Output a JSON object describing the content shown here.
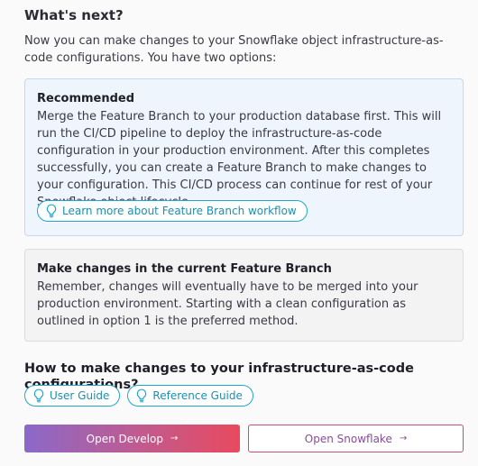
{
  "header": {
    "title": "What's next?"
  },
  "intro": "Now you can make changes to your Snowflake object infrastructure-as-code configurations. You have two options:",
  "recommended": {
    "title": "Recommended",
    "body": "Merge the Feature Branch to your production database first. This will run the CI/CD pipeline to deploy the infrastructure-as-code configuration in your production environment. After this completes successfully, you can create a Feature Branch to make changes to your configuration. This CI/CD process can continue for rest of your Snowflake object lifecycle.",
    "link_label": "Learn more about Feature Branch workflow",
    "link_icon": "lightbulb-icon"
  },
  "current_branch": {
    "title": "Make changes in the current Feature Branch",
    "body": "Remember, changes will eventually have to be merged into your production environment. Starting with a clean configuration as outlined in option 1 is the preferred method."
  },
  "howto": {
    "title": "How to make changes to your infrastructure-as-code configurations?",
    "user_guide_label": "User Guide",
    "reference_guide_label": "Reference Guide"
  },
  "actions": {
    "open_develop_label": "Open Develop",
    "open_snowflake_label": "Open Snowflake",
    "arrow": "→"
  },
  "colors": {
    "accent": "#1fa8c9",
    "gradient_start": "#8b69c9",
    "gradient_end": "#e84a5f"
  }
}
